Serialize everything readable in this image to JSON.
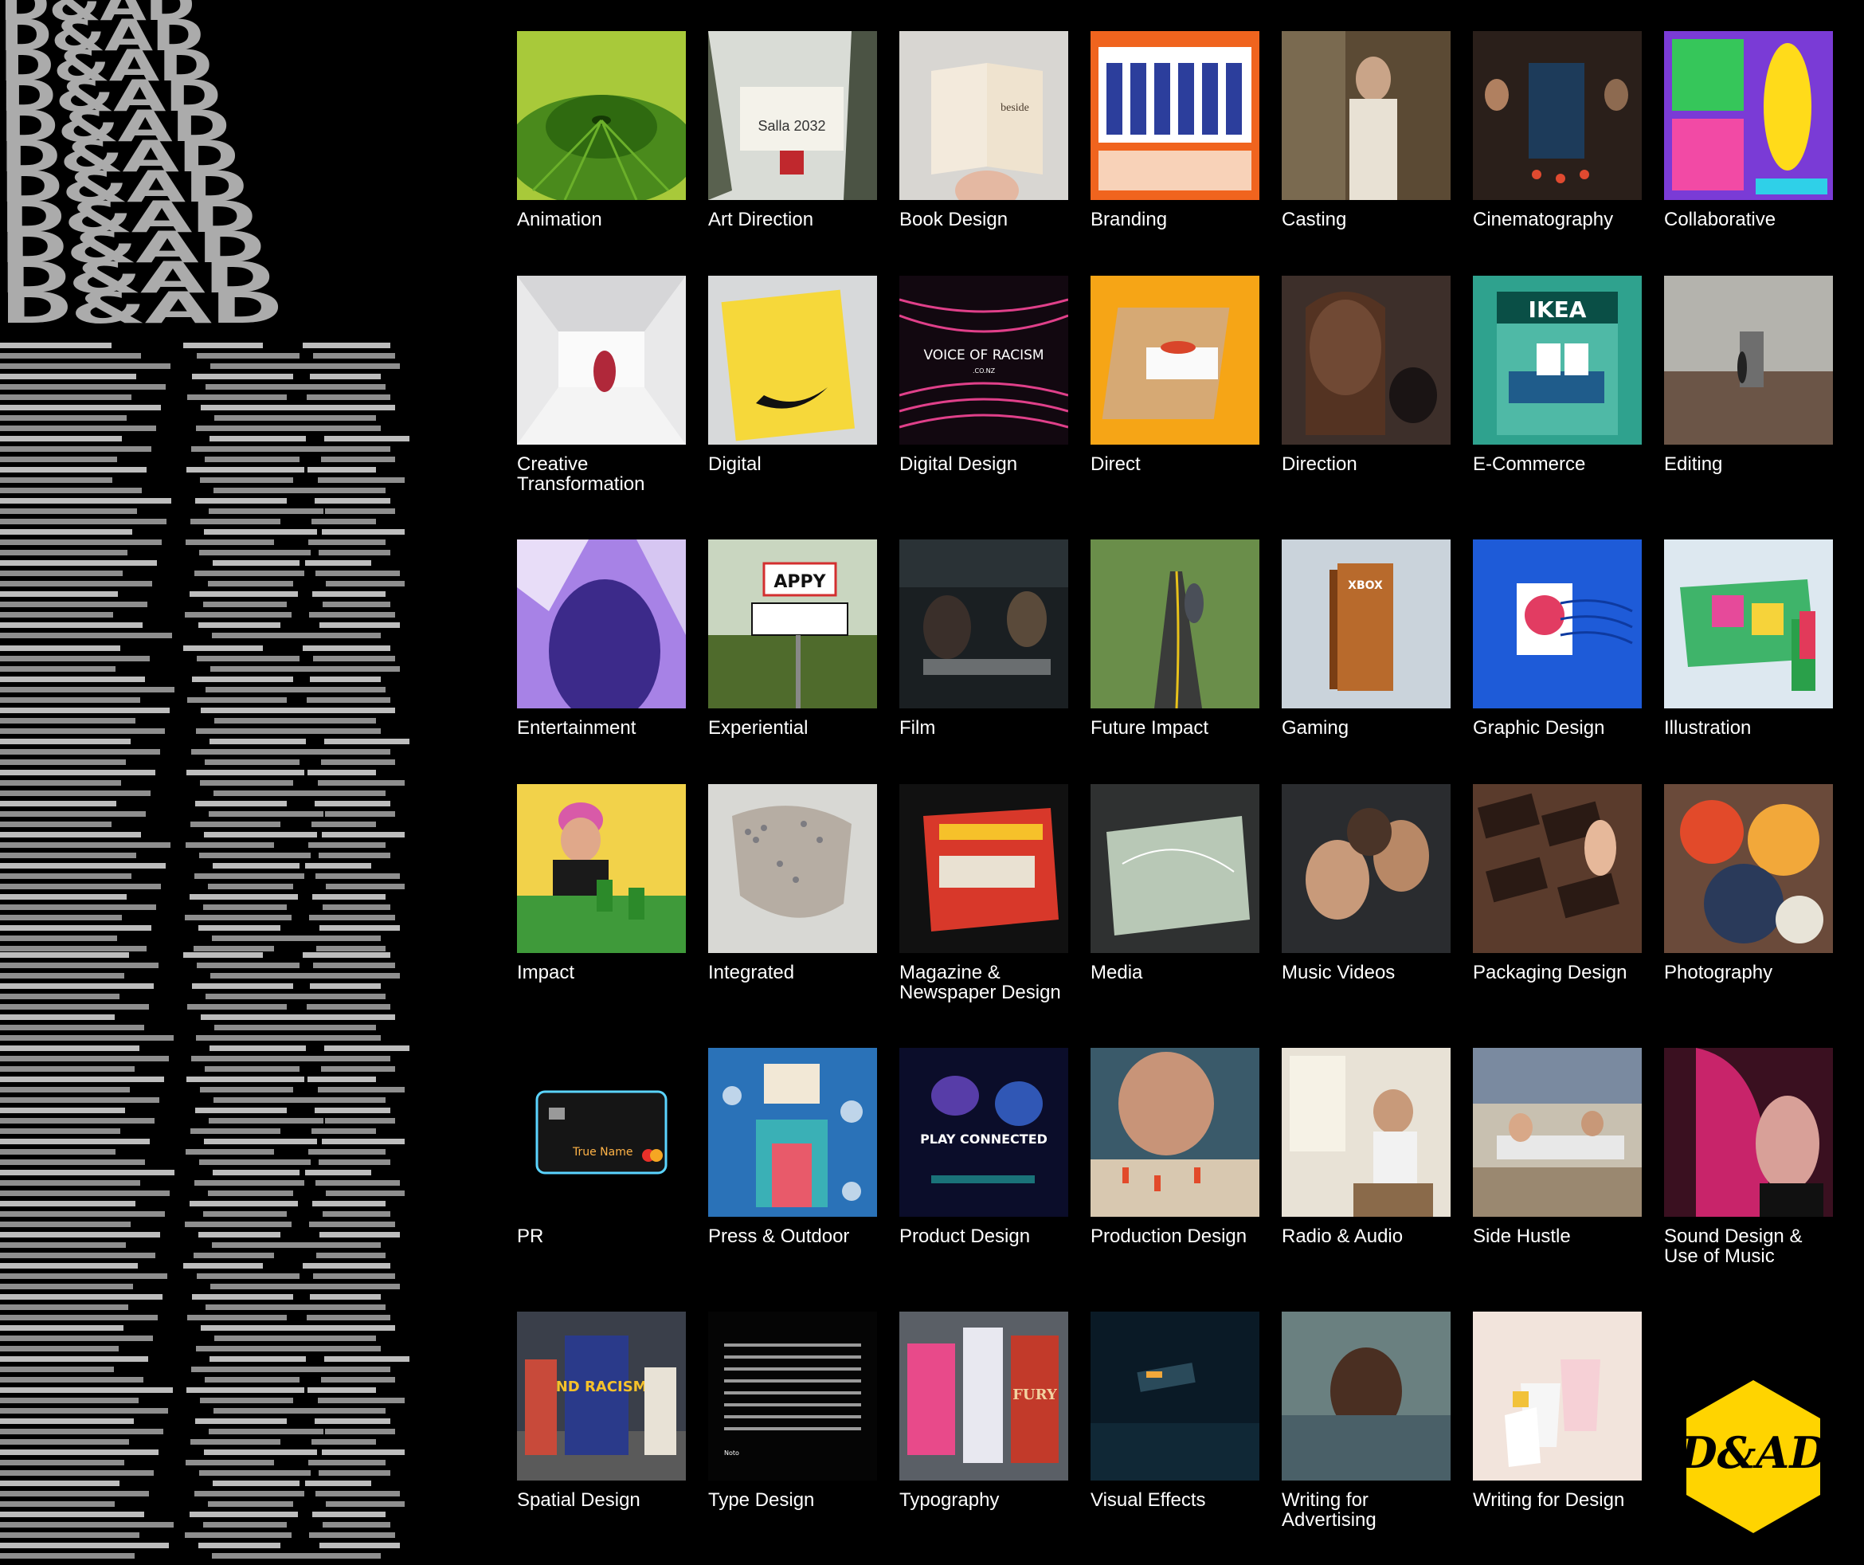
{
  "page": {
    "background": "#000000"
  },
  "brand": {
    "banner_word": "D&AD",
    "logo_color": "#FFD400",
    "logo_text": "D&AD"
  },
  "categories": [
    {
      "label": "Animation",
      "thumb": "green-leaf"
    },
    {
      "label": "Art Direction",
      "thumb": "salla-flag-forest"
    },
    {
      "label": "Book Design",
      "thumb": "open-book-hand"
    },
    {
      "label": "Branding",
      "thumb": "orange-poster-group"
    },
    {
      "label": "Casting",
      "thumb": "man-in-room"
    },
    {
      "label": "Cinematography",
      "thumb": "altar-scene"
    },
    {
      "label": "Collaborative",
      "thumb": "colorful-illustration-sandal"
    },
    {
      "label": "Creative\nTransformation",
      "thumb": "white-tunnel-shop"
    },
    {
      "label": "Digital",
      "thumb": "nike-yellow-card"
    },
    {
      "label": "Digital Design",
      "thumb": "voice-of-racism-waves",
      "overlay_text": "VOICE OF RACISM",
      "overlay_sub": ".CO.NZ"
    },
    {
      "label": "Direct",
      "thumb": "pizza-box-table"
    },
    {
      "label": "Direction",
      "thumb": "woman-with-dog"
    },
    {
      "label": "E-Commerce",
      "thumb": "ikea-catalogue",
      "overlay_text": "IKEA"
    },
    {
      "label": "Editing",
      "thumb": "door-in-moor"
    },
    {
      "label": "Entertainment",
      "thumb": "purple-shadow-figure"
    },
    {
      "label": "Experiential",
      "thumb": "happy-village-sign",
      "overlay_text": "APPY"
    },
    {
      "label": "Film",
      "thumb": "diner-night"
    },
    {
      "label": "Future Impact",
      "thumb": "runner-on-road"
    },
    {
      "label": "Gaming",
      "thumb": "xbox-book",
      "overlay_text": "XBOX"
    },
    {
      "label": "Graphic Design",
      "thumb": "blue-stamp"
    },
    {
      "label": "Illustration",
      "thumb": "folded-map"
    },
    {
      "label": "Impact",
      "thumb": "woman-pink-hair-green-cups"
    },
    {
      "label": "Integrated",
      "thumb": "crowd-map"
    },
    {
      "label": "Magazine &\nNewspaper Design",
      "thumb": "red-magazines"
    },
    {
      "label": "Media",
      "thumb": "banknote-map"
    },
    {
      "label": "Music Videos",
      "thumb": "children-crowd"
    },
    {
      "label": "Packaging Design",
      "thumb": "chocolate-bars"
    },
    {
      "label": "Photography",
      "thumb": "color-explosion"
    },
    {
      "label": "PR",
      "thumb": "black-card",
      "overlay_text": "True Name"
    },
    {
      "label": "Press & Outdoor",
      "thumb": "paris-illustration"
    },
    {
      "label": "Product Design",
      "thumb": "play-connected",
      "overlay_text": "PLAY CONNECTED"
    },
    {
      "label": "Production Design",
      "thumb": "man-face-figures"
    },
    {
      "label": "Radio & Audio",
      "thumb": "man-headphones-room"
    },
    {
      "label": "Side Hustle",
      "thumb": "classroom"
    },
    {
      "label": "Sound Design &\nUse of Music",
      "thumb": "pink-hair-profile"
    },
    {
      "label": "Spatial Design",
      "thumb": "end-racism-protest",
      "overlay_text": "END RACISM"
    },
    {
      "label": "Type Design",
      "thumb": "noto-type-grid",
      "overlay_text": "Noto"
    },
    {
      "label": "Typography",
      "thumb": "subway-posters",
      "overlay_text": "FURY"
    },
    {
      "label": "Visual Effects",
      "thumb": "bus-underwater"
    },
    {
      "label": "Writing for\nAdvertising",
      "thumb": "boy-in-water"
    },
    {
      "label": "Writing for Design",
      "thumb": "paper-cups"
    }
  ]
}
